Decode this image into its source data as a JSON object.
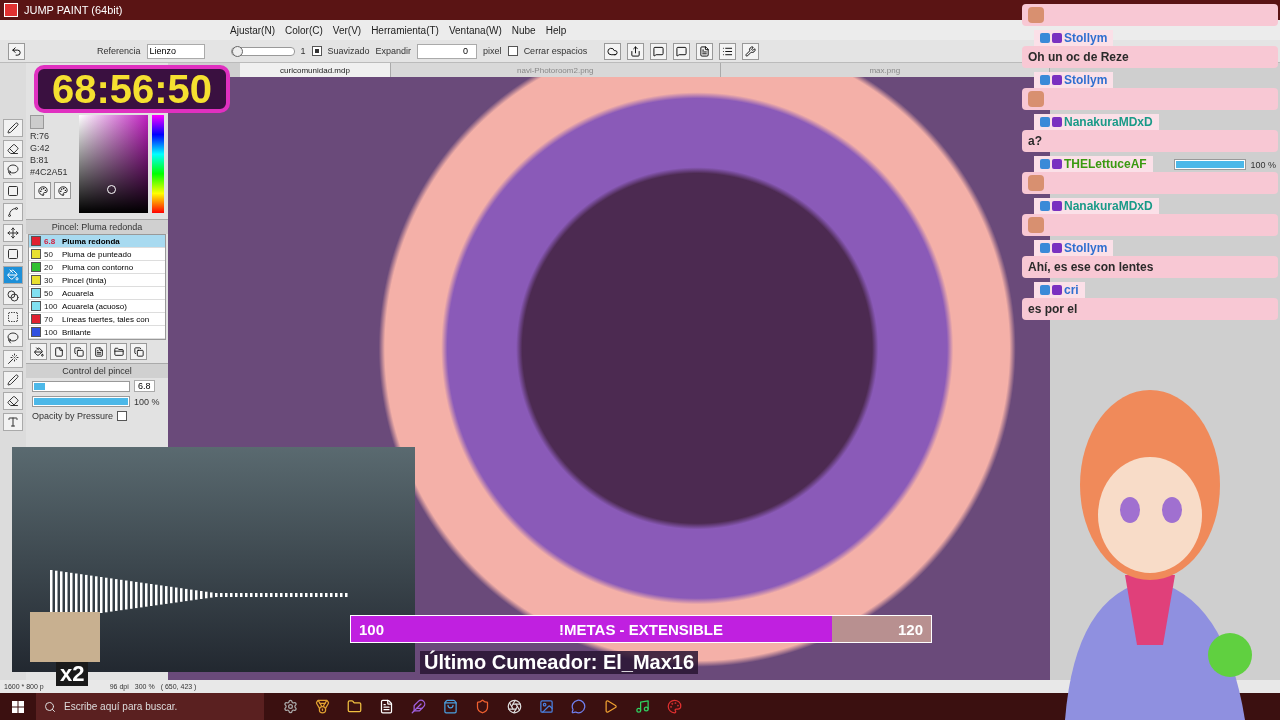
{
  "window": {
    "title": "JUMP PAINT (64bit)"
  },
  "menu": [
    "Ajustar(N)",
    "Color(C)",
    "Ver(V)",
    "Herramienta(T)",
    "Ventana(W)",
    "Nube",
    "Help"
  ],
  "timer": "68:56:50",
  "toolbar": {
    "reference_label": "Referencia",
    "reference_value": "Lienzo",
    "tolerance": {
      "level": 0,
      "value": "1"
    },
    "smoothing": {
      "label": "Suavizado",
      "checked": true
    },
    "expand_label": "Expandir",
    "expand_value": "0",
    "expand_unit": "pixel",
    "close_gaps": {
      "label": "Cerrar espacios",
      "checked": false
    }
  },
  "tabs": [
    {
      "label": "curicomunidad.mdp",
      "selected": true
    },
    {
      "label": "navi-Photoroom2.png",
      "selected": false
    },
    {
      "label": "max.png",
      "selected": false
    }
  ],
  "tools": [
    {
      "kind": "pen",
      "selected": false
    },
    {
      "kind": "eraser",
      "selected": false
    },
    {
      "kind": "lasso",
      "selected": false
    },
    {
      "kind": "rect",
      "selected": false
    },
    {
      "kind": "line",
      "selected": false
    },
    {
      "kind": "move",
      "selected": false
    },
    {
      "kind": "fill",
      "selected": false
    },
    {
      "kind": "bucket",
      "selected": true
    },
    {
      "kind": "gradient",
      "selected": false
    },
    {
      "kind": "select",
      "selected": false
    },
    {
      "kind": "lasso",
      "selected": false
    },
    {
      "kind": "wand",
      "selected": false
    },
    {
      "kind": "pen",
      "selected": false
    },
    {
      "kind": "eraser",
      "selected": false
    },
    {
      "kind": "text",
      "selected": false
    }
  ],
  "color_panel": {
    "r": "R:76",
    "g": "G:42",
    "b": "B:81",
    "hex": "#4C2A51"
  },
  "brush_panel": {
    "title": "Pincel: Pluma redonda",
    "brushes": [
      {
        "size": "6.8",
        "name": "Pluma redonda",
        "color": "#e02030",
        "selected": true
      },
      {
        "size": "50",
        "name": "Pluma de punteado",
        "color": "#e8e030",
        "selected": false
      },
      {
        "size": "20",
        "name": "Pluma con contorno",
        "color": "#30c030",
        "selected": false
      },
      {
        "size": "30",
        "name": "Pincel (tinta)",
        "color": "#e8e030",
        "selected": false
      },
      {
        "size": "50",
        "name": "Acuarela",
        "color": "#80e0f0",
        "selected": false
      },
      {
        "size": "100",
        "name": "Acuarela (acuoso)",
        "color": "#80e0f0",
        "selected": false
      },
      {
        "size": "70",
        "name": "Líneas fuertes, tales con",
        "color": "#e02030",
        "selected": false
      },
      {
        "size": "100",
        "name": "Brillante",
        "color": "#3050e0",
        "selected": false
      }
    ]
  },
  "brush_control": {
    "title": "Control del pincel",
    "size": {
      "level": 0.12,
      "value": "6.8"
    },
    "opacity": {
      "level": 1,
      "value": "100 %"
    },
    "pressure": {
      "label": "Opacity by Pressure",
      "checked": false
    }
  },
  "right_panel": {
    "opacity": {
      "level": 1,
      "value": "100 %"
    }
  },
  "chat": [
    {
      "kind": "emote"
    },
    {
      "kind": "text",
      "user": "Stollym",
      "color": "#2f6fd0",
      "text": "Oh un oc de Reze"
    },
    {
      "kind": "emote",
      "user": "Stollym",
      "color": "#2f6fd0"
    },
    {
      "kind": "text",
      "user": "NanakuraMDxD",
      "color": "#1a9a88",
      "text": "a?"
    },
    {
      "kind": "emote",
      "user": "THELettuceAF",
      "color": "#3a9a10"
    },
    {
      "kind": "emote",
      "user": "NanakuraMDxD",
      "color": "#1a9a88"
    },
    {
      "kind": "text",
      "user": "Stollym",
      "color": "#2f6fd0",
      "text": "Ahí, es ese con lentes"
    },
    {
      "kind": "text",
      "user": "cri",
      "color": "#2f6fd0",
      "text": "es por el"
    }
  ],
  "goal": {
    "start": "100",
    "label": "!METAS - EXTENSIBLE",
    "end": "120",
    "level": 0.83
  },
  "multiplier": "x2",
  "last_cumeador": "Último Cumeador: El_Max16",
  "status_bar": [
    "1600 * 800 p",
    "96 dpi",
    "300 %",
    "( 650, 423 )"
  ],
  "taskbar": {
    "search_placeholder": "Escribe aquí para buscar."
  }
}
